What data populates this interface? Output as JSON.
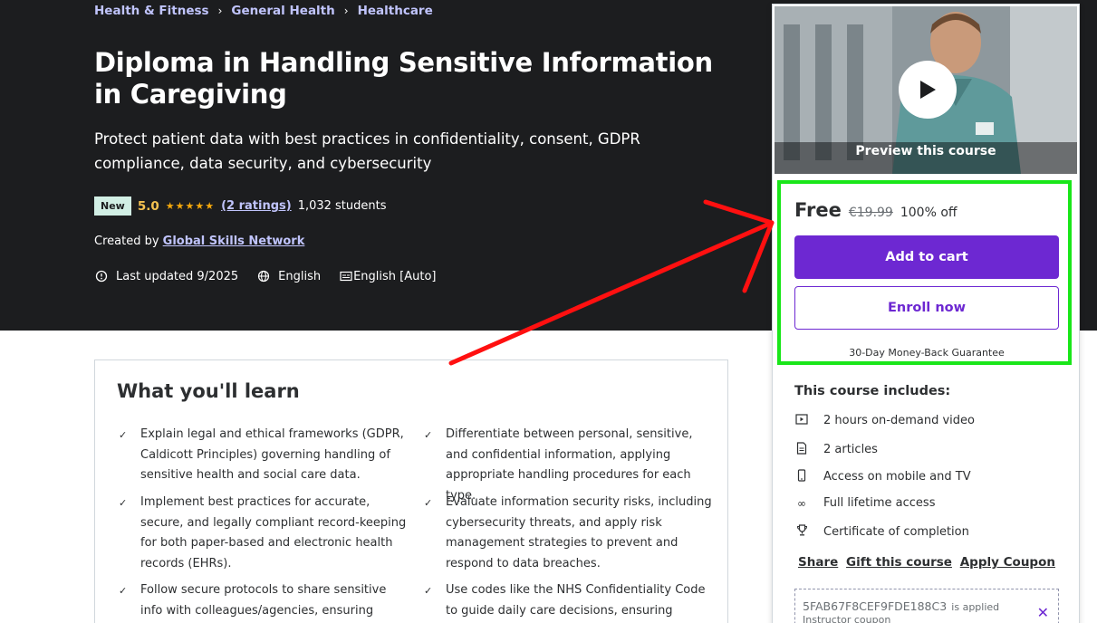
{
  "breadcrumb": [
    "Health & Fitness",
    "General Health",
    "Healthcare"
  ],
  "course": {
    "title": "Diploma in Handling Sensitive Information in Caregiving",
    "subtitle": "Protect patient data with best practices in confidentiality, consent, GDPR compliance, data security, and cybersecurity",
    "badge": "New",
    "rating": "5.0",
    "stars": "★★★★★",
    "ratings_count": "(2 ratings)",
    "students": "1,032 students",
    "created_by_label": "Created by",
    "author": "Global Skills Network",
    "last_updated": "Last updated 9/2025",
    "language": "English",
    "captions": "English [Auto]"
  },
  "learn": {
    "title": "What you'll learn",
    "items": [
      "Explain legal and ethical frameworks (GDPR, Caldicott Principles) governing handling of sensitive health and social care data.",
      "Differentiate between personal, sensitive, and confidential information, applying appropriate handling procedures for each type.",
      "Implement best practices for accurate, secure, and legally compliant record-keeping for both paper-based and electronic health records (EHRs).",
      "Evaluate information security risks, including cybersecurity threats, and apply risk management strategies to prevent and respond to data breaches.",
      "Follow secure protocols to share sensitive info with colleagues/agencies, ensuring patient",
      "Use codes like the NHS Confidentiality Code to guide daily care decisions, ensuring"
    ]
  },
  "sidebar": {
    "preview_label": "Preview this course",
    "price": "Free",
    "original_price": "€19.99",
    "discount": "100% off",
    "add_to_cart": "Add to cart",
    "enroll_now": "Enroll now",
    "guarantee": "30-Day Money-Back Guarantee",
    "includes_title": "This course includes:",
    "includes": [
      {
        "icon": "video-icon",
        "text": "2 hours on-demand video"
      },
      {
        "icon": "article-icon",
        "text": "2 articles"
      },
      {
        "icon": "mobile-icon",
        "text": "Access on mobile and TV"
      },
      {
        "icon": "infinity-icon",
        "text": "Full lifetime access"
      },
      {
        "icon": "trophy-icon",
        "text": "Certificate of completion"
      }
    ],
    "share": "Share",
    "gift": "Gift this course",
    "apply_coupon": "Apply Coupon",
    "coupon_code": "5FAB67F8CEF9FDE188C3",
    "coupon_applied": "is applied",
    "coupon_type": "Instructor coupon"
  },
  "colors": {
    "hero_bg": "#1c1d1f",
    "accent_purple": "#6d28d2",
    "link_lavender": "#c0c4fc",
    "star_gold": "#f4c150",
    "highlight_green": "#19e619",
    "arrow_red": "#ff1010"
  }
}
